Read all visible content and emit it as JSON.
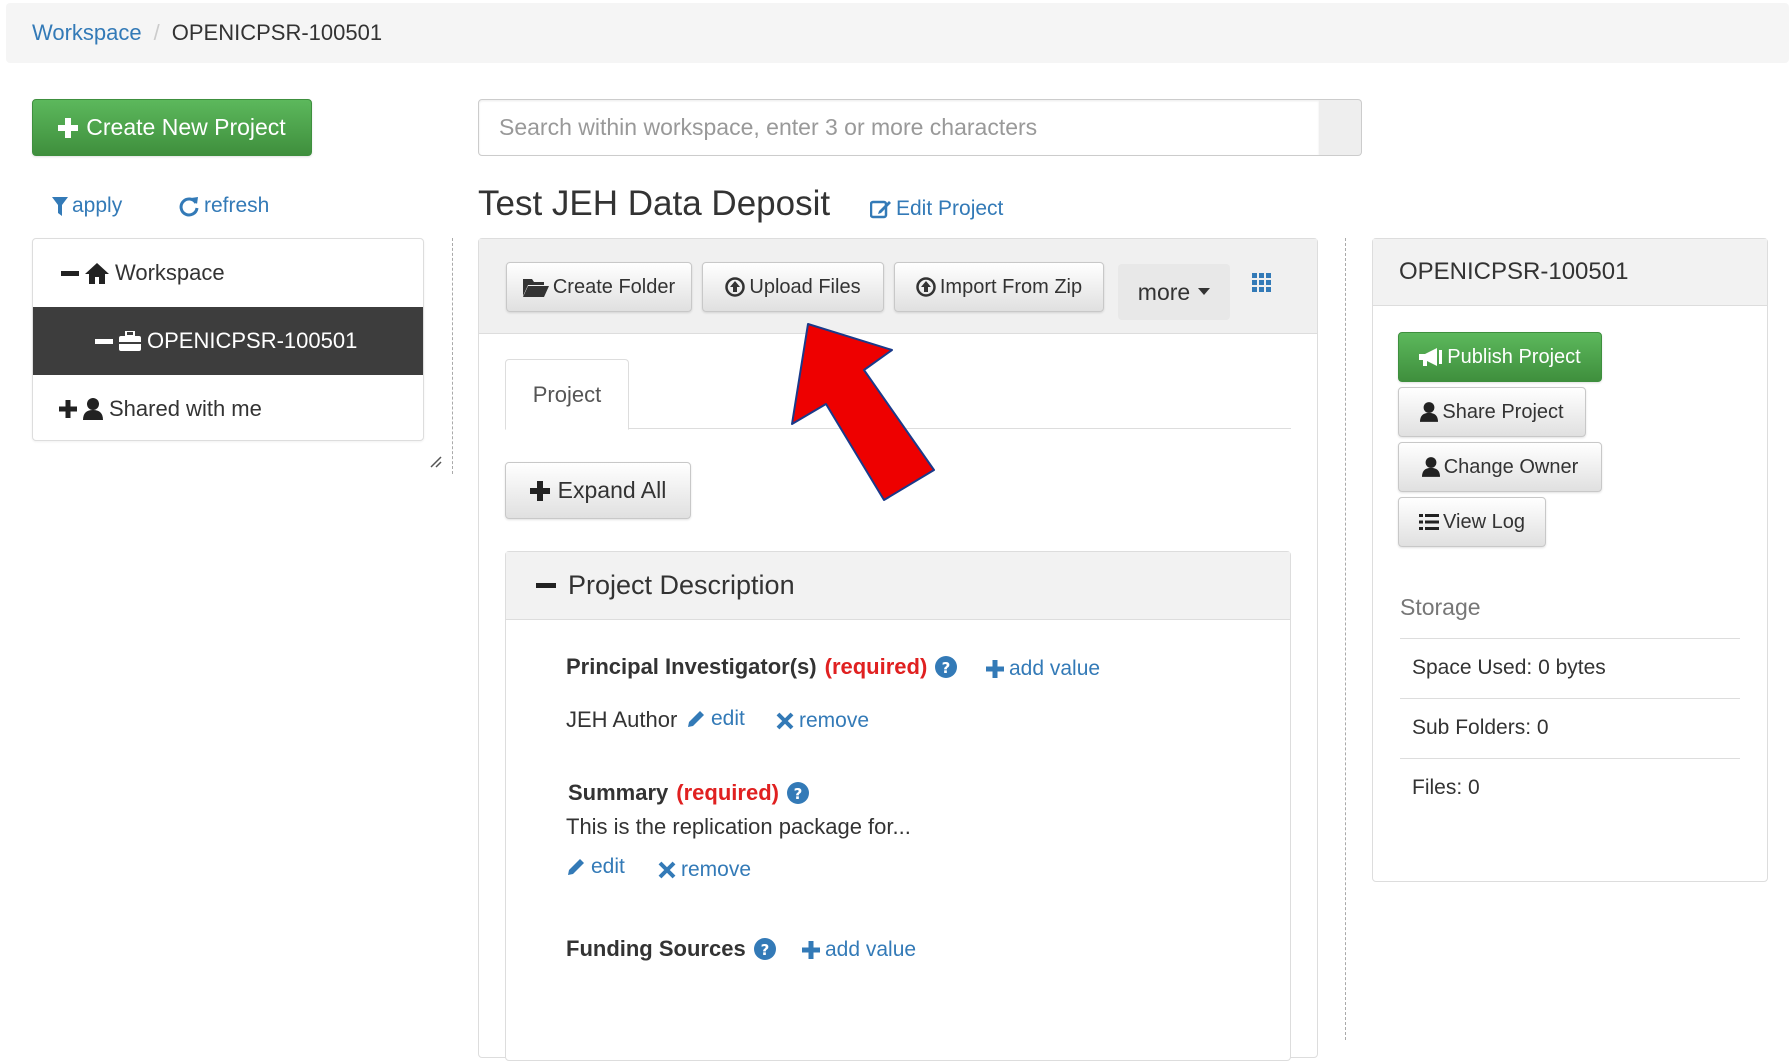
{
  "breadcrumb": {
    "root": "Workspace",
    "separator": "/",
    "current": "OPENICPSR-100501"
  },
  "sidebar": {
    "create_button": "Create New Project",
    "apply_label": "apply",
    "refresh_label": "refresh",
    "tree": [
      {
        "label": "Workspace",
        "toggle": "minus",
        "icon": "home-icon"
      },
      {
        "label": "OPENICPSR-100501",
        "toggle": "minus",
        "icon": "briefcase-icon",
        "selected": true
      },
      {
        "label": "Shared with me",
        "toggle": "plus",
        "icon": "user-icon"
      }
    ]
  },
  "search": {
    "placeholder": "Search within workspace, enter 3 or more characters",
    "value": ""
  },
  "project": {
    "title": "Test JEH Data Deposit",
    "edit_label": "Edit Project",
    "toolbar": {
      "create_folder": "Create Folder",
      "upload_files": "Upload Files",
      "import_zip": "Import From Zip",
      "more": "more"
    },
    "tabs": [
      {
        "label": "Project",
        "active": true
      }
    ],
    "expand_all": "Expand All",
    "description": {
      "header": "Project Description",
      "fields": [
        {
          "label": "Principal Investigator(s)",
          "required": "(required)",
          "add_value": "add value",
          "value": "JEH Author",
          "edit": "edit",
          "remove": "remove"
        },
        {
          "label": "Summary",
          "required": "(required)",
          "value": "This is the replication package for...",
          "edit": "edit",
          "remove": "remove"
        },
        {
          "label": "Funding Sources",
          "add_value": "add value"
        }
      ]
    }
  },
  "details": {
    "title": "OPENICPSR-100501",
    "buttons": {
      "publish": "Publish Project",
      "share": "Share Project",
      "change_owner": "Change Owner",
      "view_log": "View Log"
    },
    "storage": {
      "title": "Storage",
      "rows": [
        "Space Used: 0 bytes",
        "Sub Folders: 0",
        "Files: 0"
      ]
    }
  },
  "colors": {
    "link": "#337ab7",
    "success": "#449d44",
    "required": "#e02020",
    "annotation_arrow": "#ee0000",
    "tree_selected": "#3d3d3d"
  }
}
